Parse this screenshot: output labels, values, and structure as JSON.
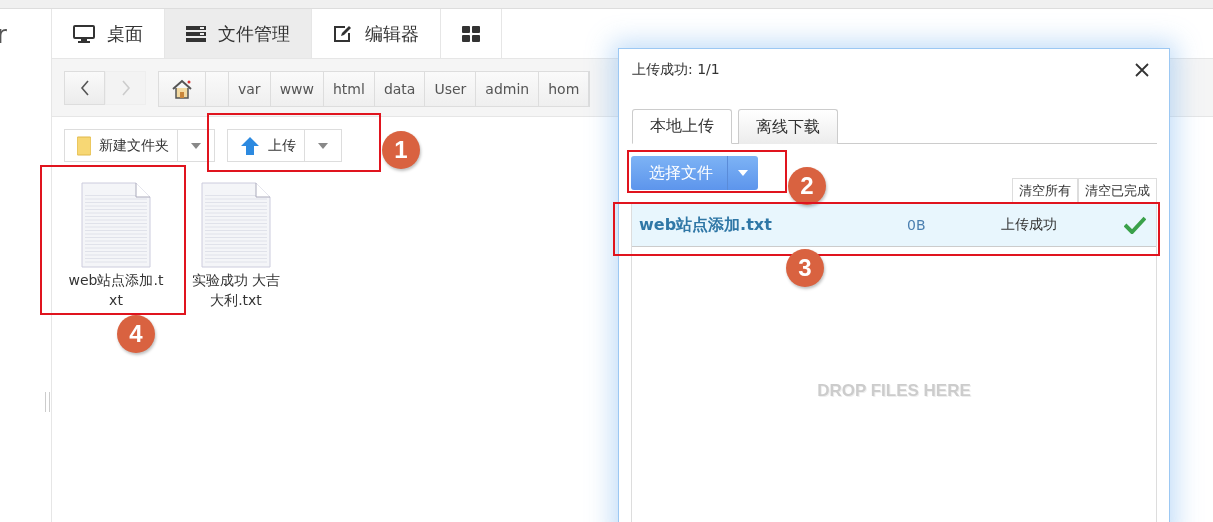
{
  "sidebar": {
    "title": "r"
  },
  "tabs": [
    {
      "label": "桌面",
      "selected": false
    },
    {
      "label": "文件管理",
      "selected": true
    },
    {
      "label": "编辑器",
      "selected": false
    },
    {
      "kind": "icon",
      "selected": false
    }
  ],
  "nav": {
    "back_disabled": false,
    "forward_disabled": true
  },
  "breadcrumb": [
    "var",
    "www",
    "html",
    "data",
    "User",
    "admin",
    "hom"
  ],
  "toolbar": [
    {
      "label": "新建文件夹"
    },
    {
      "label": "上传"
    }
  ],
  "files": [
    {
      "name": "web站点添加.txt"
    },
    {
      "name": "实验成功 大吉大利.txt"
    }
  ],
  "dialog": {
    "title": "上传成功: 1/1",
    "tabs": [
      {
        "label": "本地上传",
        "selected": true
      },
      {
        "label": "离线下载",
        "selected": false
      }
    ],
    "choose_button": "选择文件",
    "actions": [
      "清空所有",
      "清空已完成"
    ],
    "uploads": [
      {
        "name": "web站点添加.txt",
        "size": "0B",
        "status": "上传成功",
        "done": true
      }
    ],
    "drop_hint": "DROP FILES HERE"
  },
  "annotations": [
    {
      "number": "1"
    },
    {
      "number": "2"
    },
    {
      "number": "3"
    },
    {
      "number": "4"
    }
  ]
}
